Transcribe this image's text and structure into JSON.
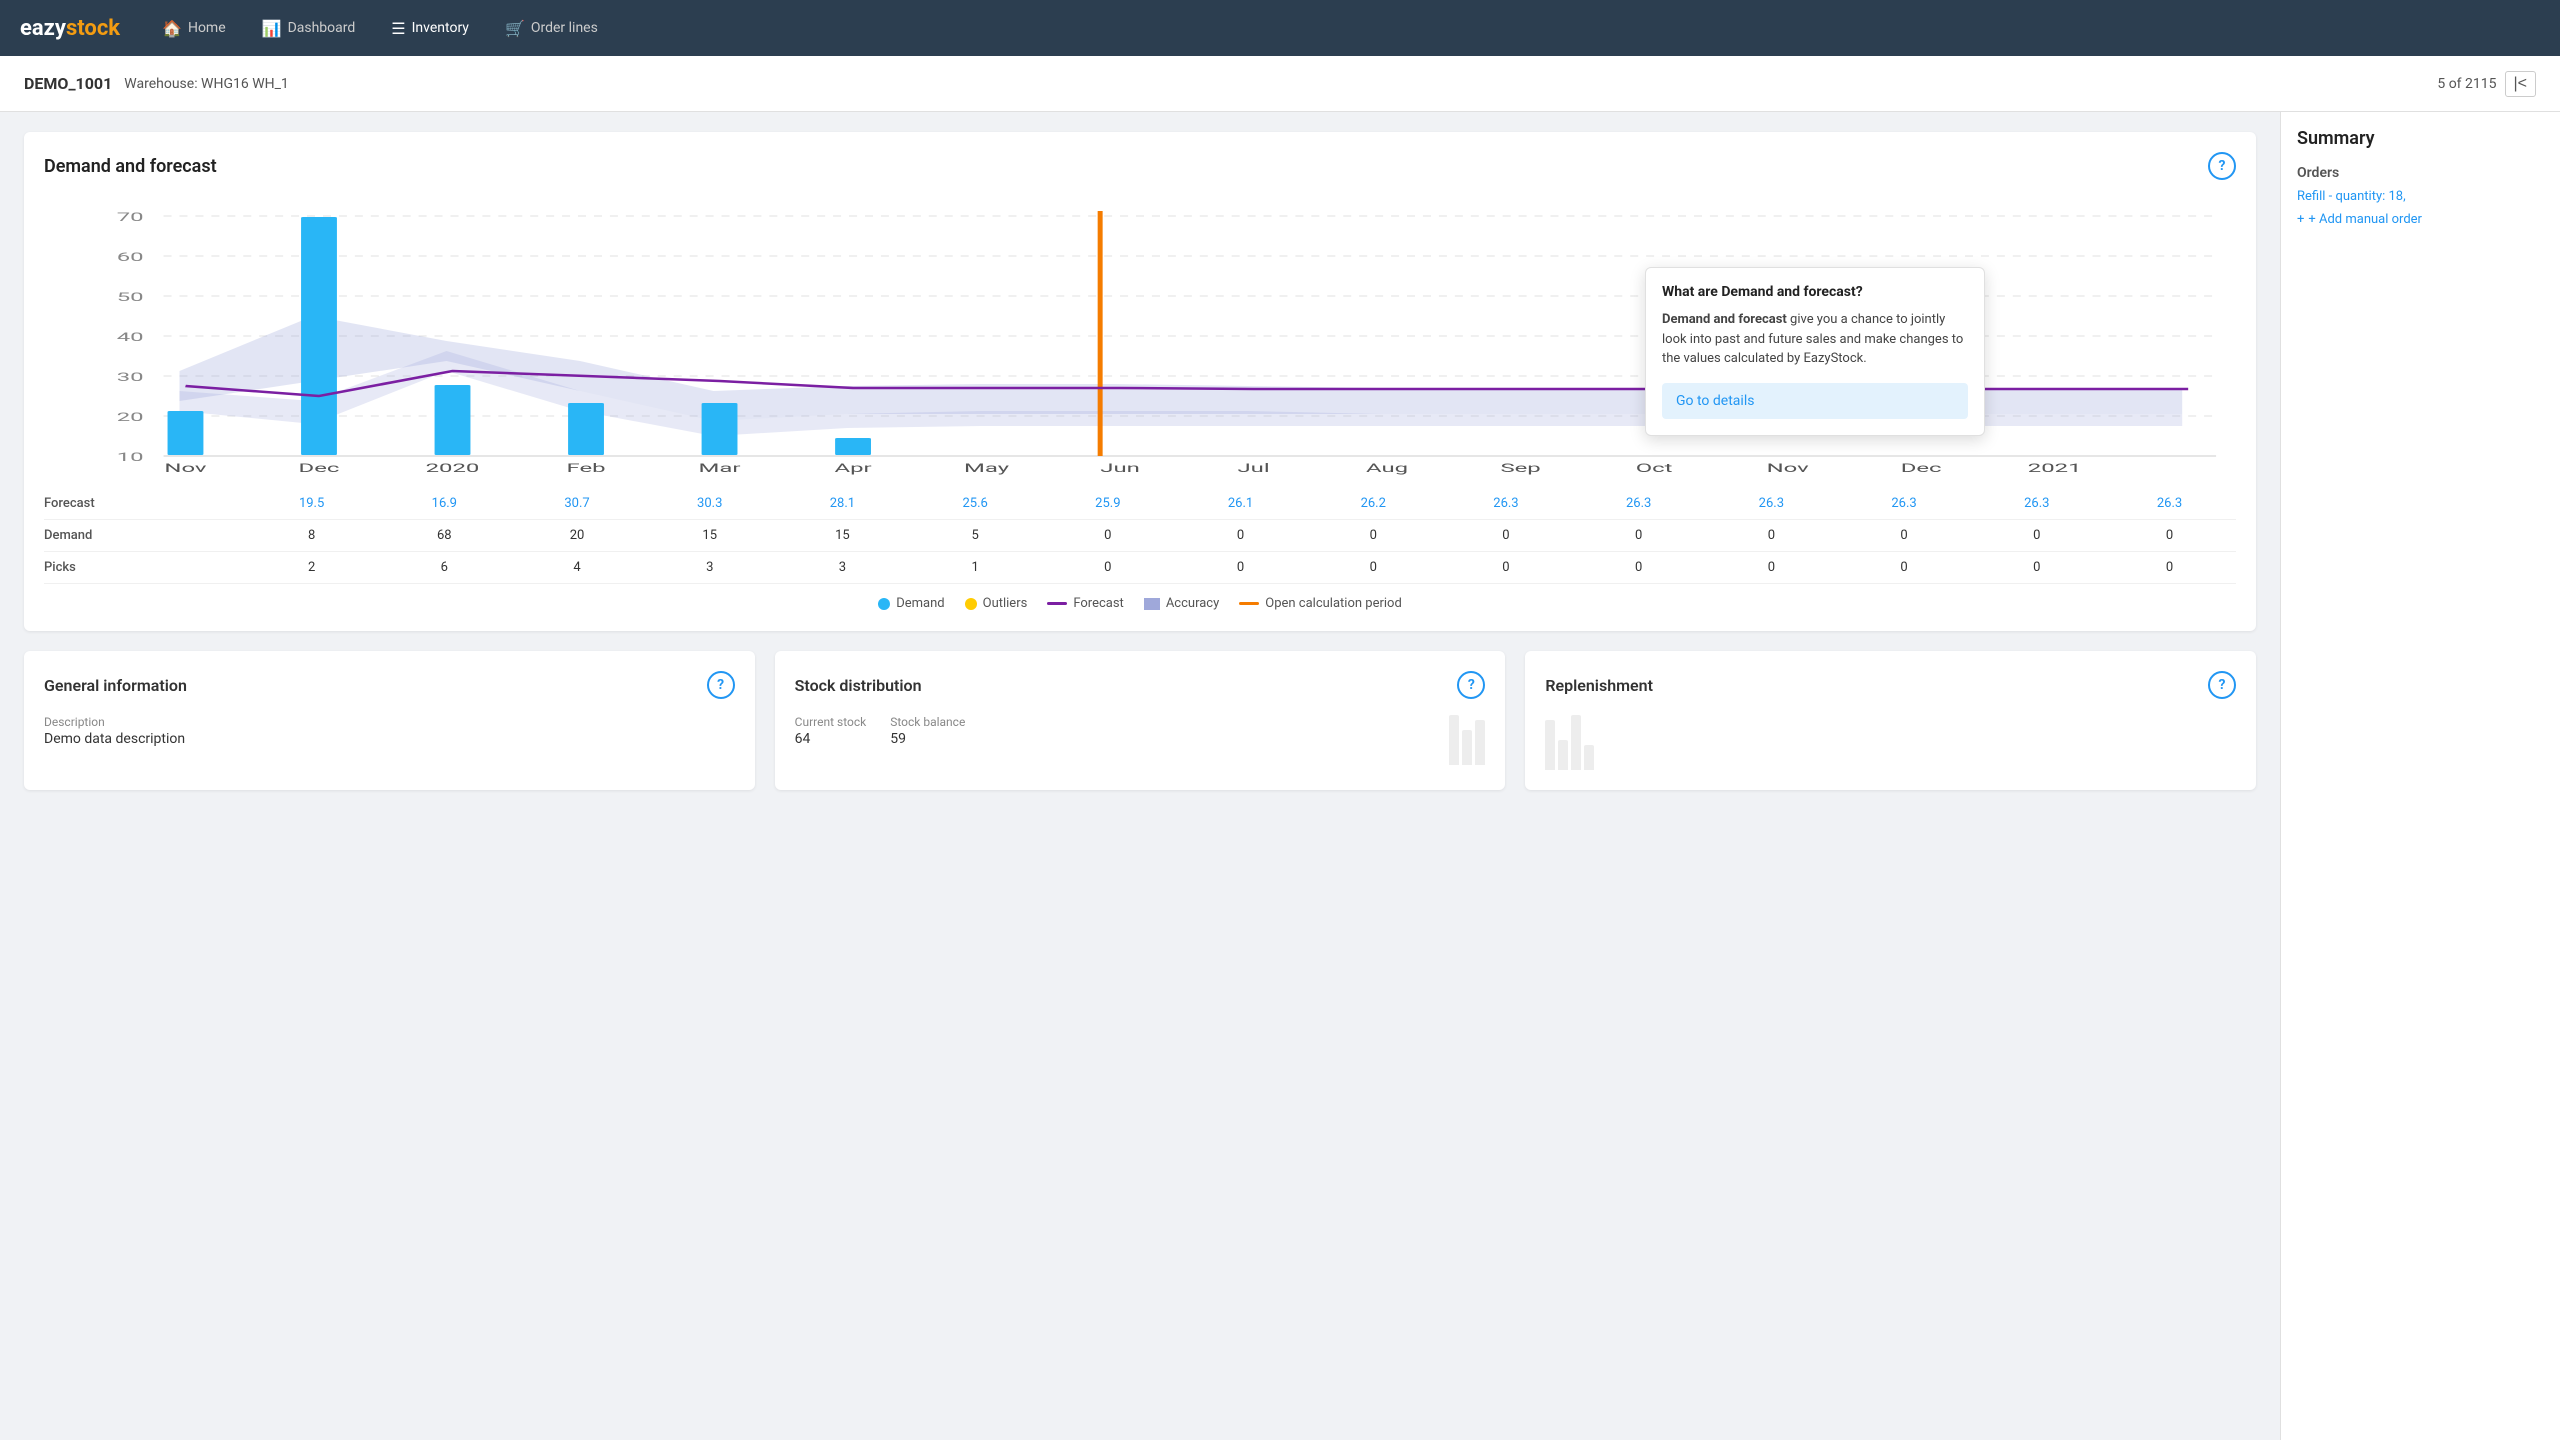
{
  "brand": {
    "name_part1": "eazy",
    "name_part2": "stock"
  },
  "nav": {
    "items": [
      {
        "label": "Home",
        "icon": "🏠",
        "active": false
      },
      {
        "label": "Dashboard",
        "icon": "📊",
        "active": false
      },
      {
        "label": "Inventory",
        "icon": "☰",
        "active": true
      },
      {
        "label": "Order lines",
        "icon": "🛒",
        "active": false
      }
    ]
  },
  "breadcrumb": {
    "id": "DEMO_1001",
    "warehouse": "Warehouse: WHG16 WH_1",
    "pagination": "5 of 2115"
  },
  "chart": {
    "title": "Demand and forecast",
    "months": [
      "Nov",
      "Dec",
      "2020",
      "Feb",
      "Mar",
      "Apr",
      "May",
      "Jun",
      "Jul",
      "Aug",
      "Sep",
      "Oct",
      "Nov",
      "Dec",
      "2021"
    ],
    "forecast": [
      19.5,
      16.9,
      30.7,
      30.3,
      28.1,
      25.6,
      25.9,
      26.1,
      26.2,
      26.3,
      26.3,
      26.3,
      26.3,
      26.3,
      26.3
    ],
    "demand": [
      8,
      68,
      20,
      15,
      15,
      5,
      0,
      0,
      0,
      0,
      0,
      0,
      0,
      0,
      0
    ],
    "picks": [
      2,
      6,
      4,
      3,
      3,
      1,
      0,
      0,
      0,
      0,
      0,
      0,
      0,
      0,
      0
    ]
  },
  "table": {
    "rows": [
      {
        "label": "Forecast",
        "values": [
          "19.5",
          "16.9",
          "30.7",
          "30.3",
          "28.1",
          "25.6",
          "25.9",
          "26.1",
          "26.2",
          "26.3",
          "26.3",
          "26.3",
          "26.3",
          "26.3",
          "26.3"
        ],
        "type": "blue"
      },
      {
        "label": "Demand",
        "values": [
          "8",
          "68",
          "20",
          "15",
          "15",
          "5",
          "0",
          "0",
          "0",
          "0",
          "0",
          "0",
          "0",
          "0",
          "0"
        ],
        "type": "normal"
      },
      {
        "label": "Picks",
        "values": [
          "2",
          "6",
          "4",
          "3",
          "3",
          "1",
          "0",
          "0",
          "0",
          "0",
          "0",
          "0",
          "0",
          "0",
          "0"
        ],
        "type": "normal"
      }
    ]
  },
  "legend": {
    "items": [
      {
        "label": "Demand",
        "type": "dot",
        "color": "#29b6f6"
      },
      {
        "label": "Outliers",
        "type": "dot",
        "color": "#ffcc02"
      },
      {
        "label": "Forecast",
        "type": "line",
        "color": "#7B1FA2"
      },
      {
        "label": "Accuracy",
        "type": "area",
        "color": "#c5cae9"
      },
      {
        "label": "Open calculation period",
        "type": "vline",
        "color": "#f57c00"
      }
    ]
  },
  "tooltip": {
    "title": "What are Demand and forecast?",
    "bold_word": "Demand and forecast",
    "body": "give you a chance to jointly look into past and future sales and make changes to the values calculated by EazyStock.",
    "link": "Go to details"
  },
  "summary": {
    "title": "Summary",
    "orders_title": "Orders",
    "order_link": "Refill - quantity: 18,",
    "add_order": "+ Add manual order"
  },
  "general_info": {
    "title": "General information",
    "description_label": "Description",
    "description_value": "Demo data description"
  },
  "stock_distribution": {
    "title": "Stock distribution",
    "current_stock_label": "Current stock",
    "current_stock_value": "64",
    "stock_balance_label": "Stock balance",
    "stock_balance_value": "59"
  },
  "replenishment": {
    "title": "Replenishment"
  }
}
